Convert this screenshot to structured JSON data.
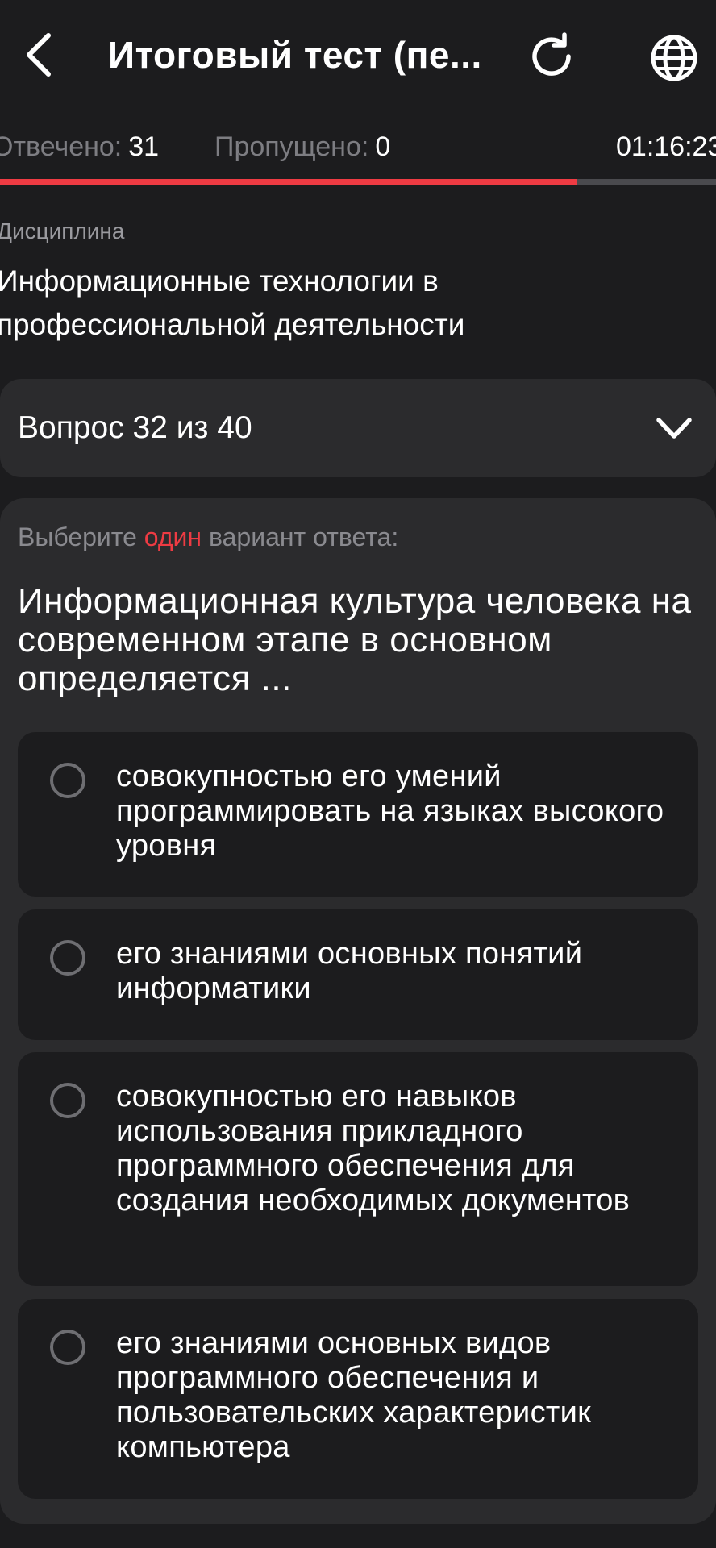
{
  "header": {
    "title": "Итоговый тест (пе...",
    "back_icon": "chevron-left-icon",
    "refresh_icon": "refresh-icon",
    "language_icon": "globe-icon"
  },
  "stats": {
    "answered_label": "Отвечено:",
    "answered_value": "31",
    "skipped_label": "Пропущено:",
    "skipped_value": "0",
    "timer": "01:16:23"
  },
  "progress": {
    "fraction": 0.805,
    "fill_color": "#ee3b43",
    "track_color": "#4a4a4e"
  },
  "discipline": {
    "label": "Дисциплина",
    "name": "Информационные технологии в профессиональной деятельности"
  },
  "question_selector": {
    "label": "Вопрос 32 из 40"
  },
  "question": {
    "instruction_prefix": "Выберите ",
    "instruction_accent": "один",
    "instruction_suffix": " вариант ответа:",
    "text": "Информационная культура человека на современном этапе в основном определяется ...",
    "options": [
      {
        "text": "совокупностью его умений программировать на языках высокого уровня",
        "selected": false
      },
      {
        "text": "его знаниями основных понятий информатики",
        "selected": false
      },
      {
        "text": "совокупностью его навыков использования прикладного программного обеспечения для создания необходимых документов",
        "selected": false
      },
      {
        "text": "его знаниями основных видов программного обеспечения и пользовательских характеристик компьютера",
        "selected": false
      }
    ]
  },
  "colors": {
    "background": "#1c1c1e",
    "card": "#2b2b2d",
    "accent": "#ee3b43"
  }
}
